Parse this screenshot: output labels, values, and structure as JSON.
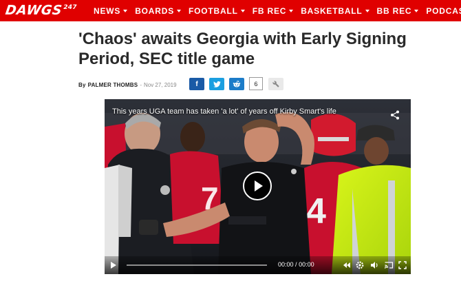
{
  "site": {
    "logo_text": "DAWGS",
    "logo_suffix": "247",
    "brand_color": "#e00000"
  },
  "nav": {
    "items": [
      {
        "label": "NEWS",
        "has_dropdown": true
      },
      {
        "label": "BOARDS",
        "has_dropdown": true
      },
      {
        "label": "FOOTBALL",
        "has_dropdown": true
      },
      {
        "label": "FB REC",
        "has_dropdown": true
      },
      {
        "label": "BASKETBALL",
        "has_dropdown": true
      },
      {
        "label": "BB REC",
        "has_dropdown": true
      },
      {
        "label": "PODCASTS",
        "has_dropdown": false
      }
    ]
  },
  "article": {
    "headline": "'Chaos' awaits Georgia with Early Signing Period, SEC title game",
    "byline_prefix": "By",
    "author": "PALMER THOMBS",
    "byline_separator": "-",
    "date": "Nov 27, 2019"
  },
  "share": {
    "facebook_icon": "f",
    "twitter_icon": "twitter-bird-icon",
    "reddit_icon": "reddit-icon",
    "count": "6",
    "tools_icon": "wrench-icon"
  },
  "video": {
    "title": "This years UGA team has taken 'a lot' of years off Kirby Smart's life",
    "current_time": "00:00",
    "duration": "00:00",
    "time_separator": "/",
    "progress": 0
  }
}
